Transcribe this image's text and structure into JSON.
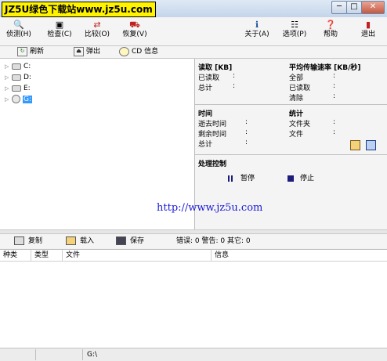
{
  "window": {
    "watermark": "JZ5U绿色下载站www.jz5u.com",
    "controls": {
      "minimize": "─",
      "maximize": "□",
      "close": "✕"
    }
  },
  "toolbar": {
    "detect": "侦测(H)",
    "check": "检查(C)",
    "compare": "比较(O)",
    "restore": "恢复(V)",
    "about": "关于(A)",
    "options": "选项(P)",
    "help": "帮助",
    "exit": "退出"
  },
  "subbar": {
    "refresh": "刷新",
    "eject": "弹出",
    "cd_info": "CD 信息"
  },
  "drives": [
    "C:",
    "D:",
    "E:",
    "G:"
  ],
  "selected_drive": "G:",
  "info": {
    "read_title": "读取 [KB]",
    "read_done": "已读取",
    "read_total": "总计",
    "rate_title": "平均传输速率 [KB/秒]",
    "rate_all": "全部",
    "rate_read": "已读取",
    "rate_clear": "清除",
    "time_title": "时间",
    "time_elapsed": "逝去时间",
    "time_remaining": "剩余时间",
    "time_total": "总计",
    "stats_title": "统计",
    "stats_folders": "文件夹",
    "stats_files": "文件",
    "process_title": "处理控制",
    "pause": "暂停",
    "stop": "停止",
    "colon": ":"
  },
  "watermark_url": "http://www.jz5u.com",
  "logbar": {
    "copy": "复制",
    "load": "载入",
    "save": "保存",
    "counts": "错误: 0 警告: 0 其它: 0"
  },
  "log_columns": [
    "种类",
    "类型",
    "文件",
    "信息"
  ],
  "status": {
    "path": "G:\\"
  },
  "colors": {
    "accent": "#3399ff",
    "link": "#1a1ad8",
    "watermark_bg": "#fff300"
  }
}
